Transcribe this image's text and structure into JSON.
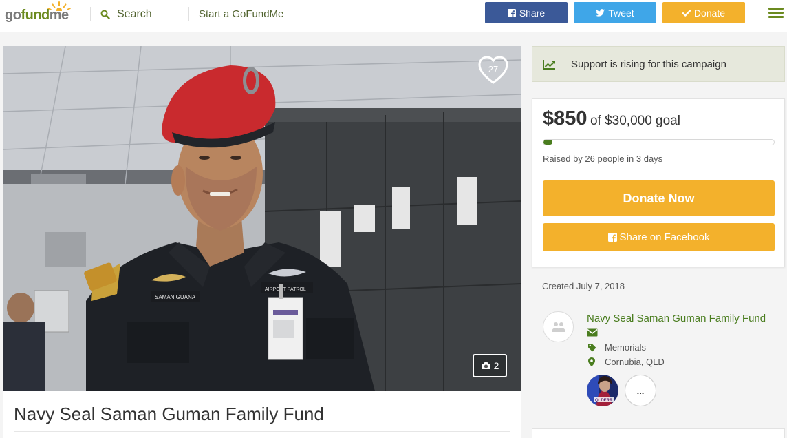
{
  "header": {
    "logo": {
      "go": "go",
      "fund": "fund",
      "me": "me"
    },
    "search_label": "Search",
    "search_icon": "search-icon",
    "start_label": "Start a GoFundMe",
    "share_label": "Share",
    "tweet_label": "Tweet",
    "donate_label": "Donate",
    "colors": {
      "share": "#3b5998",
      "tweet": "#3fa6e8",
      "donate": "#f3b12c",
      "brand_green": "#6b8a1f"
    }
  },
  "hero": {
    "heart_count": "27",
    "photo_count": "2",
    "uniform_name_tag": "SAMAN GUANA",
    "uniform_patch": "AIRPORT PATROL"
  },
  "campaign": {
    "title": "Navy Seal Saman Guman Family Fund",
    "rising_text": "Support is rising for this campaign",
    "amount": "$850",
    "goal_text": "of $30,000 goal",
    "progress_fraction": 0.028,
    "raised_text": "Raised by 26 people in 3 days",
    "donate_now_label": "Donate Now",
    "share_facebook_label": "Share on Facebook",
    "created_text": "Created July 7, 2018"
  },
  "organizer": {
    "name": "Navy Seal Saman Guman Family Fund",
    "category": "Memorials",
    "location": "Cornubia, QLD",
    "more_label": "...",
    "donor_avatar_label": "QLDERR"
  }
}
